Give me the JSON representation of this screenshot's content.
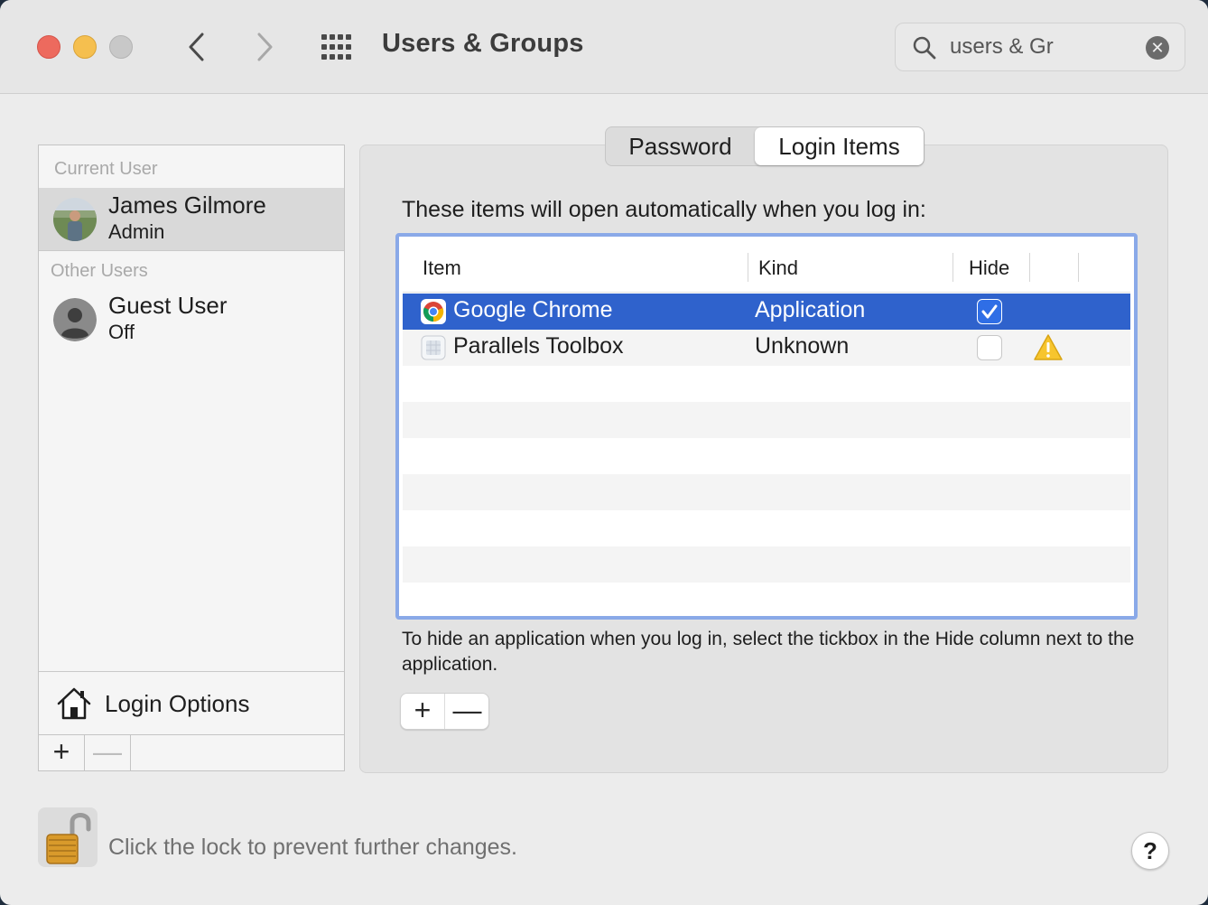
{
  "window": {
    "title": "Users & Groups"
  },
  "search": {
    "value": "users & Gr"
  },
  "sidebar": {
    "current_user_label": "Current User",
    "current_user": {
      "name": "James Gilmore",
      "role": "Admin"
    },
    "other_users_label": "Other Users",
    "other_users": [
      {
        "name": "Guest User",
        "status": "Off"
      }
    ],
    "login_options_label": "Login Options",
    "add_label": "+",
    "remove_label": "—"
  },
  "tabs": [
    {
      "label": "Password",
      "selected": false
    },
    {
      "label": "Login Items",
      "selected": true
    }
  ],
  "login_items": {
    "intro": "These items will open automatically when you log in:",
    "columns": {
      "item": "Item",
      "kind": "Kind",
      "hide": "Hide"
    },
    "rows": [
      {
        "item": "Google Chrome",
        "kind": "Application",
        "hide": true,
        "icon": "chrome-icon",
        "warning": false
      },
      {
        "item": "Parallels Toolbox",
        "kind": "Unknown",
        "hide": false,
        "icon": "parallels-toolbox-icon",
        "warning": true
      }
    ],
    "hint": "To hide an application when you log in, select the tickbox in the Hide column next to the application.",
    "add_label": "+",
    "remove_label": "—"
  },
  "footer": {
    "lock_text": "Click the lock to prevent further changes.",
    "help_label": "?"
  },
  "colors": {
    "selection": "#2f62cc",
    "focus_ring": "#8aa9e8",
    "close": "#ed6a5e",
    "minimize": "#f5bf4f"
  }
}
